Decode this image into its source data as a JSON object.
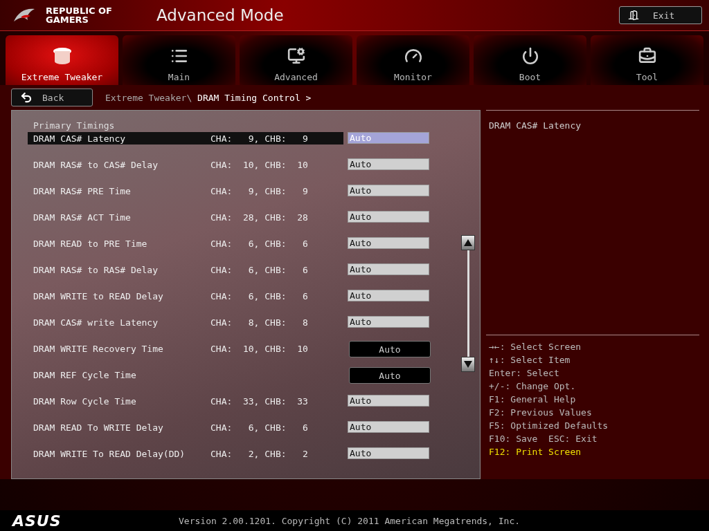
{
  "header": {
    "brand": "REPUBLIC OF GAMERS",
    "title": "Advanced Mode",
    "exit_button": "Exit"
  },
  "tabs": [
    {
      "label": "Extreme Tweaker",
      "kind": "tweaker",
      "selected": true
    },
    {
      "label": "Main",
      "kind": "main",
      "selected": false
    },
    {
      "label": "Advanced",
      "kind": "advanced",
      "selected": false
    },
    {
      "label": "Monitor",
      "kind": "monitor",
      "selected": false
    },
    {
      "label": "Boot",
      "kind": "boot",
      "selected": false
    },
    {
      "label": "Tool",
      "kind": "tool",
      "selected": false
    }
  ],
  "back_button": "Back",
  "breadcrumb": {
    "path": "Extreme Tweaker\\",
    "current": "DRAM Timing Control >"
  },
  "section_title": "Primary Timings",
  "rows": [
    {
      "label": "DRAM CAS# Latency",
      "channels": "CHA:   9, CHB:   9",
      "value": "Auto",
      "kind": "input",
      "selected": true
    },
    {
      "label": "DRAM RAS# to CAS# Delay",
      "channels": "CHA:  10, CHB:  10",
      "value": "Auto",
      "kind": "input",
      "selected": false
    },
    {
      "label": "DRAM RAS# PRE Time",
      "channels": "CHA:   9, CHB:   9",
      "value": "Auto",
      "kind": "input",
      "selected": false
    },
    {
      "label": "DRAM RAS# ACT Time",
      "channels": "CHA:  28, CHB:  28",
      "value": "Auto",
      "kind": "input",
      "selected": false
    },
    {
      "label": "DRAM READ to PRE Time",
      "channels": "CHA:   6, CHB:   6",
      "value": "Auto",
      "kind": "input",
      "selected": false
    },
    {
      "label": "DRAM RAS# to RAS# Delay",
      "channels": "CHA:   6, CHB:   6",
      "value": "Auto",
      "kind": "input",
      "selected": false
    },
    {
      "label": "DRAM WRITE to READ Delay",
      "channels": "CHA:   6, CHB:   6",
      "value": "Auto",
      "kind": "input",
      "selected": false
    },
    {
      "label": "DRAM CAS# write Latency",
      "channels": "CHA:   8, CHB:   8",
      "value": "Auto",
      "kind": "input",
      "selected": false
    },
    {
      "label": "DRAM WRITE Recovery Time",
      "channels": "CHA:  10, CHB:  10",
      "value": "Auto",
      "kind": "dropdown",
      "selected": false
    },
    {
      "label": "DRAM REF Cycle Time",
      "value": "Auto",
      "kind": "dropdown",
      "selected": false
    },
    {
      "label": "DRAM Row Cycle Time",
      "channels": "CHA:  33, CHB:  33",
      "value": "Auto",
      "kind": "input",
      "selected": false
    },
    {
      "label": "DRAM READ To WRITE Delay",
      "channels": "CHA:   6, CHB:   6",
      "value": "Auto",
      "kind": "input",
      "selected": false
    },
    {
      "label": "DRAM WRITE To READ Delay(DD)",
      "channels": "CHA:   2, CHB:   2",
      "value": "Auto",
      "kind": "input",
      "selected": false
    }
  ],
  "help": {
    "description": "DRAM CAS# Latency",
    "keys": [
      {
        "text": "→←: Select Screen",
        "highlighted": false
      },
      {
        "text": "↑↓: Select Item",
        "highlighted": false
      },
      {
        "text": "Enter: Select",
        "highlighted": false
      },
      {
        "text": "+/-: Change Opt.",
        "highlighted": false
      },
      {
        "text": "F1: General Help",
        "highlighted": false
      },
      {
        "text": "F2: Previous Values",
        "highlighted": false
      },
      {
        "text": "F5: Optimized Defaults",
        "highlighted": false
      },
      {
        "text": "F10: Save  ESC: Exit",
        "highlighted": false
      },
      {
        "text": "F12: Print Screen",
        "highlighted": true
      }
    ]
  },
  "footer": {
    "logo": "ASUS",
    "version": "Version 2.00.1201. Copyright (C) 2011 American Megatrends, Inc."
  }
}
